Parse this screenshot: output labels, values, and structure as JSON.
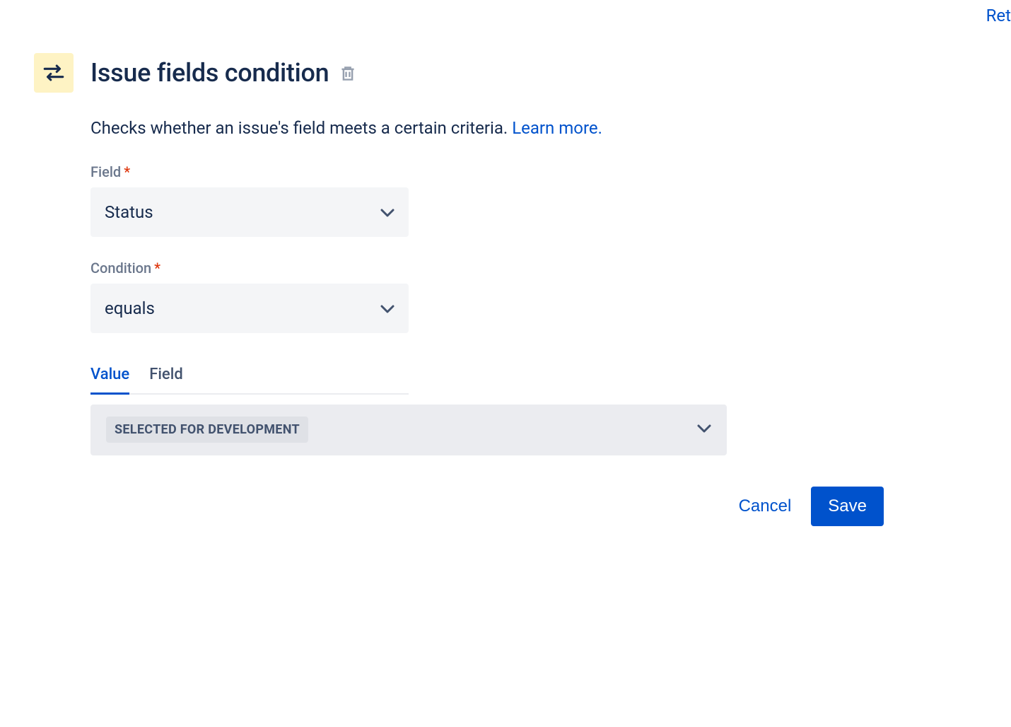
{
  "topRight": {
    "label": "Ret"
  },
  "header": {
    "title": "Issue fields condition"
  },
  "description": {
    "text": "Checks whether an issue's field meets a certain criteria. ",
    "learnMore": "Learn more."
  },
  "form": {
    "field": {
      "label": "Field",
      "value": "Status"
    },
    "condition": {
      "label": "Condition",
      "value": "equals"
    },
    "tabs": {
      "value": "Value",
      "field": "Field"
    },
    "valueSelect": {
      "selected": "SELECTED FOR DEVELOPMENT"
    }
  },
  "footer": {
    "cancel": "Cancel",
    "save": "Save"
  }
}
